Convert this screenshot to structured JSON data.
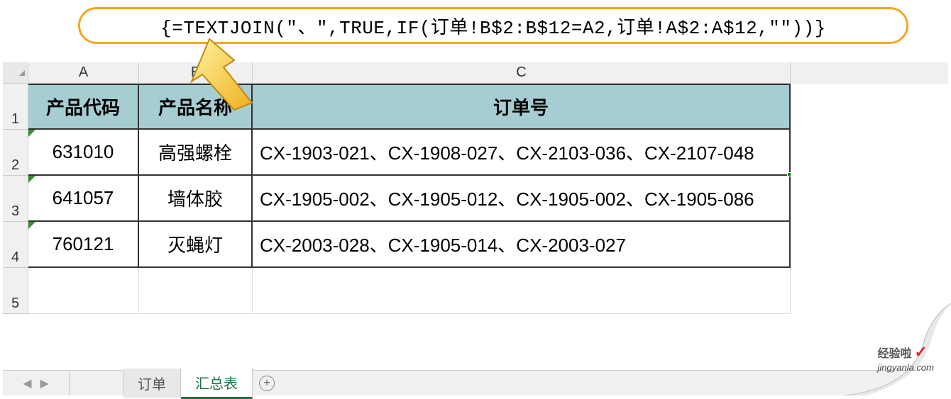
{
  "formula": "{=TEXTJOIN(\"、\",TRUE,IF(订单!B$2:B$12=A2,订单!A$2:A$12,\"\"))}",
  "columns": {
    "A": "A",
    "B": "B",
    "C": "C"
  },
  "rowNums": {
    "r1": "1",
    "r2": "2",
    "r3": "3",
    "r4": "4",
    "r5": "5"
  },
  "headers": {
    "code": "产品代码",
    "name": "产品名称",
    "order": "订单号"
  },
  "rows": [
    {
      "code": "631010",
      "name": "高强螺栓",
      "order": "CX-1903-021、CX-1908-027、CX-2103-036、CX-2107-048"
    },
    {
      "code": "641057",
      "name": "墙体胶",
      "order": "CX-1905-002、CX-1905-012、CX-1905-002、CX-1905-086"
    },
    {
      "code": "760121",
      "name": "灭蝇灯",
      "order": "CX-2003-028、CX-1905-014、CX-2003-027"
    }
  ],
  "tabs": {
    "sheet1": "订单",
    "sheet2": "汇总表"
  },
  "watermark": {
    "brand": "经验啦",
    "check": "✓",
    "url": "jingyanla.com"
  }
}
